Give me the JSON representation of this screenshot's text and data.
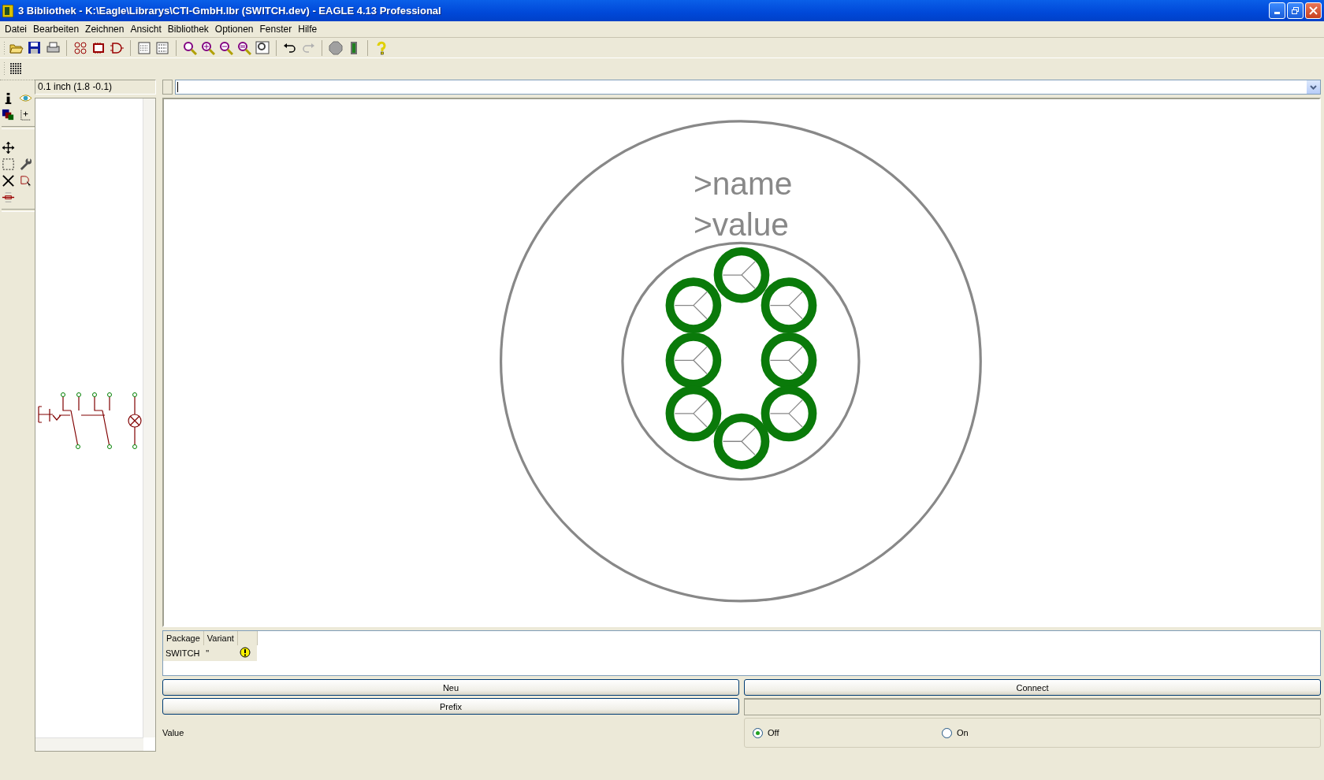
{
  "window": {
    "title": "3 Bibliothek - K:\\Eagle\\Librarys\\CTI-GmbH.lbr (SWITCH.dev) - EAGLE 4.13 Professional"
  },
  "menu": [
    "Datei",
    "Bearbeiten",
    "Zeichnen",
    "Ansicht",
    "Bibliothek",
    "Optionen",
    "Fenster",
    "Hilfe"
  ],
  "grid_readout": "0.1 inch (1.8 -0.1)",
  "canvas": {
    "name_label": ">name",
    "value_label": ">value"
  },
  "packages": {
    "columns": [
      "Package",
      "Variant"
    ],
    "rows": [
      {
        "package": "SWITCH",
        "variant": "\""
      }
    ]
  },
  "buttons": [
    "Neu",
    "Connect",
    "Prefix"
  ],
  "value": {
    "label": "Value",
    "options": [
      {
        "label": "Off",
        "selected": true
      },
      {
        "label": "On",
        "selected": false
      }
    ]
  }
}
